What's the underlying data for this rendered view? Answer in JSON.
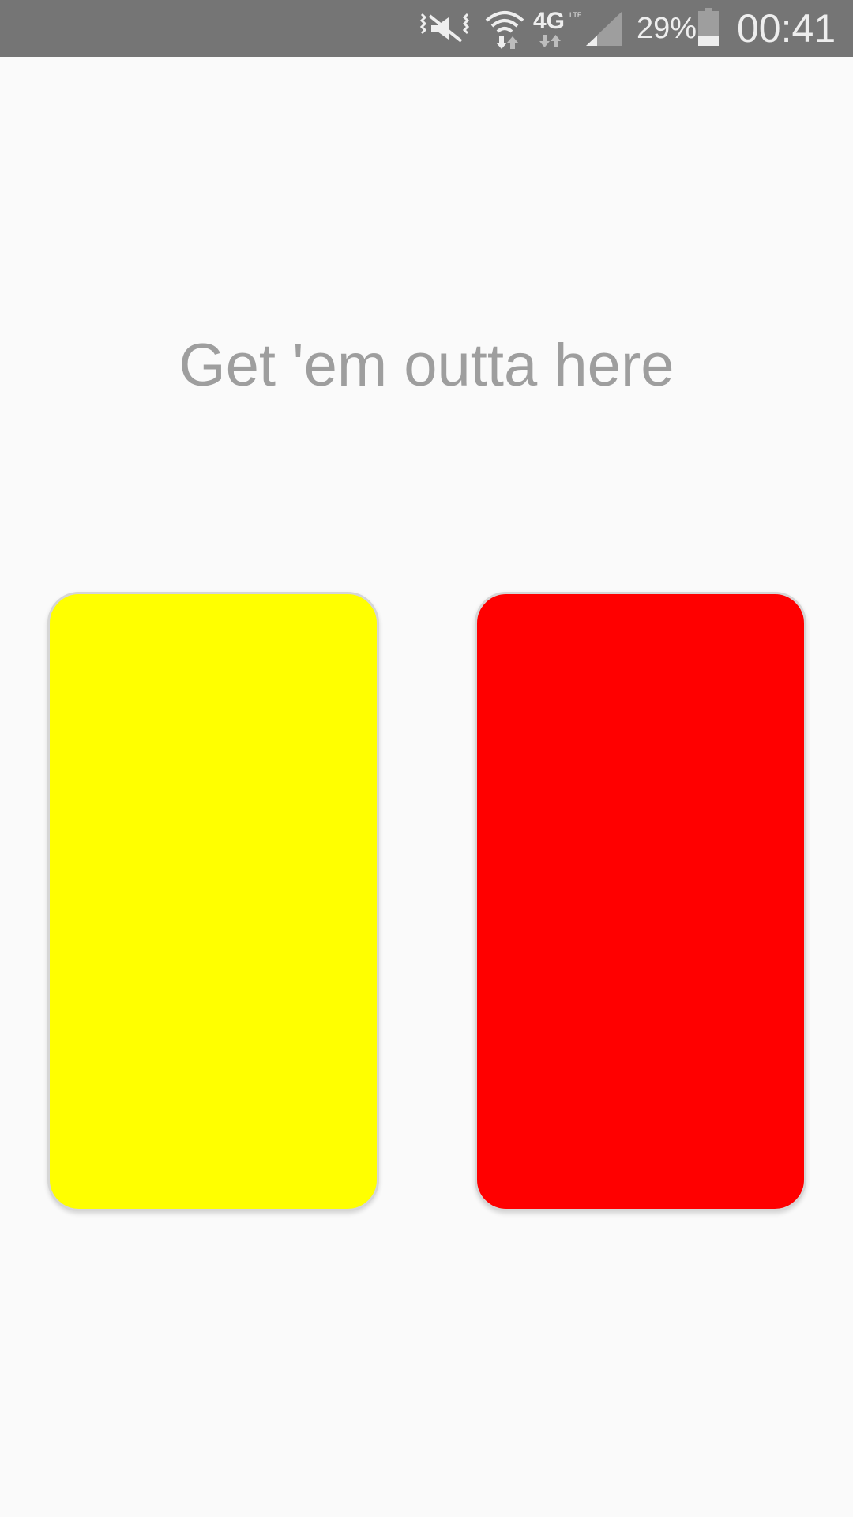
{
  "status_bar": {
    "icons": [
      "vibrate-icon",
      "wifi-icon",
      "4g-lte-icon",
      "signal-icon",
      "battery-icon"
    ],
    "battery_percent": "29%",
    "time": "00:41",
    "background_color": "#757575"
  },
  "main": {
    "headline": "Get 'em outta here",
    "cards": [
      {
        "name": "yellow-card",
        "color": "#ffff00"
      },
      {
        "name": "red-card",
        "color": "#ff0000"
      }
    ]
  },
  "colors": {
    "background": "#fafafa",
    "headline_text": "#9e9e9e",
    "card_border": "#d6d6d6"
  }
}
